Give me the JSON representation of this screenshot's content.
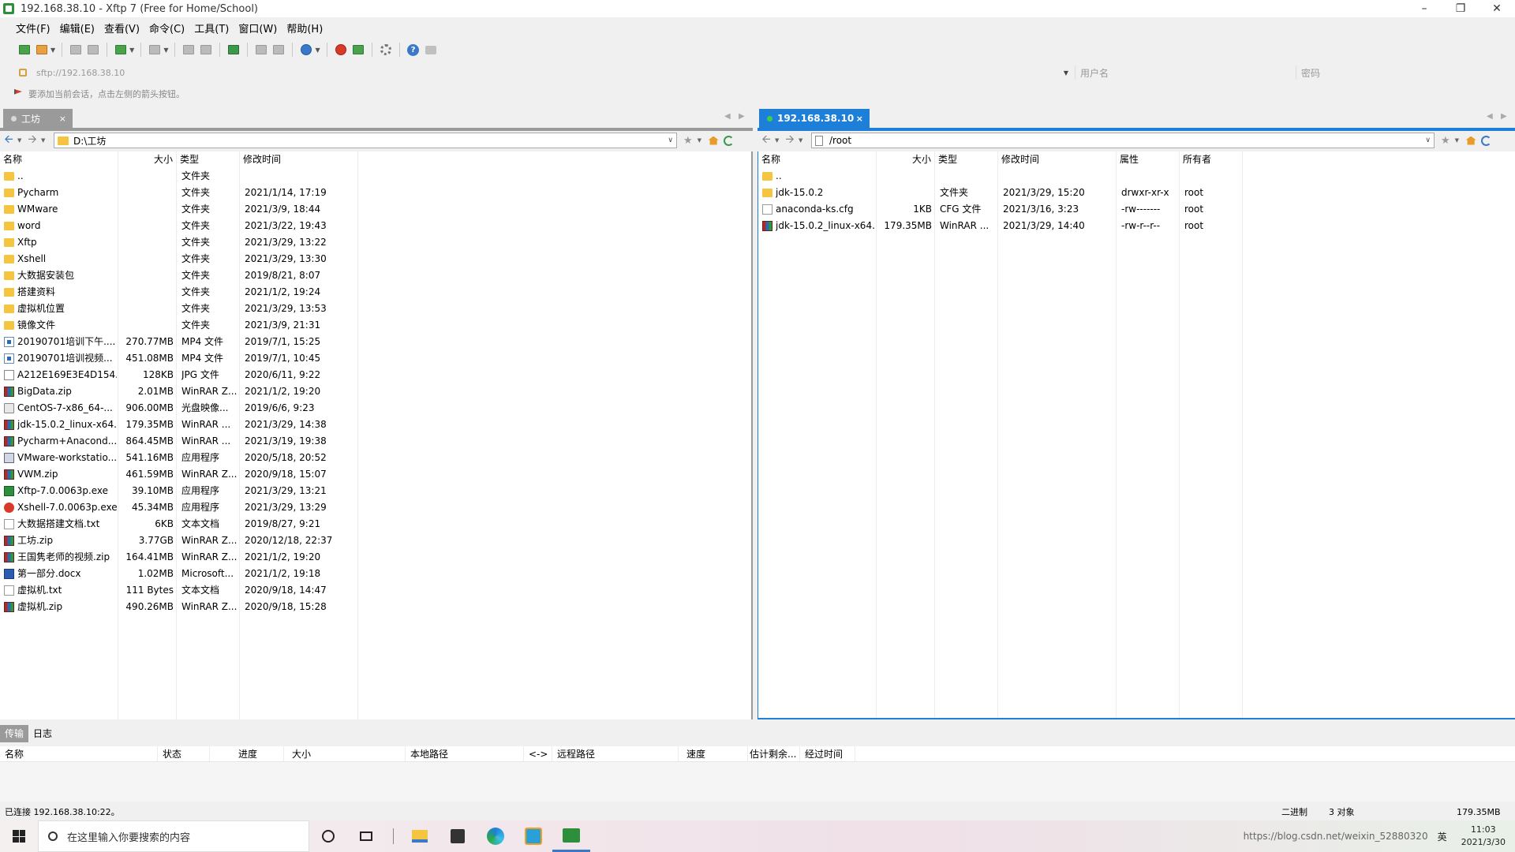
{
  "window": {
    "title": "192.168.38.10 - Xftp 7 (Free for Home/School)"
  },
  "menu": [
    "文件(F)",
    "编辑(E)",
    "查看(V)",
    "命令(C)",
    "工具(T)",
    "窗口(W)",
    "帮助(H)"
  ],
  "address": {
    "value": "sftp://192.168.38.10",
    "username_placeholder": "用户名",
    "password_placeholder": "密码"
  },
  "hint": "要添加当前会话，点击左侧的箭头按钮。",
  "local": {
    "tab_label": "工坊",
    "path": "D:\\工坊",
    "columns": [
      "名称",
      "大小",
      "类型",
      "修改时间"
    ],
    "rows": [
      {
        "icon": "folder",
        "name": "..",
        "size": "",
        "type": "文件夹",
        "mtime": ""
      },
      {
        "icon": "folder",
        "name": "Pycharm",
        "size": "",
        "type": "文件夹",
        "mtime": "2021/1/14, 17:19"
      },
      {
        "icon": "folder",
        "name": "WMware",
        "size": "",
        "type": "文件夹",
        "mtime": "2021/3/9, 18:44"
      },
      {
        "icon": "folder",
        "name": "word",
        "size": "",
        "type": "文件夹",
        "mtime": "2021/3/22, 19:43"
      },
      {
        "icon": "folder",
        "name": "Xftp",
        "size": "",
        "type": "文件夹",
        "mtime": "2021/3/29, 13:22"
      },
      {
        "icon": "folder",
        "name": "Xshell",
        "size": "",
        "type": "文件夹",
        "mtime": "2021/3/29, 13:30"
      },
      {
        "icon": "folder",
        "name": "大数据安装包",
        "size": "",
        "type": "文件夹",
        "mtime": "2019/8/21, 8:07"
      },
      {
        "icon": "folder",
        "name": "搭建资料",
        "size": "",
        "type": "文件夹",
        "mtime": "2021/1/2, 19:24"
      },
      {
        "icon": "folder",
        "name": "虚拟机位置",
        "size": "",
        "type": "文件夹",
        "mtime": "2021/3/29, 13:53"
      },
      {
        "icon": "folder",
        "name": "镜像文件",
        "size": "",
        "type": "文件夹",
        "mtime": "2021/3/9, 21:31"
      },
      {
        "icon": "video",
        "name": "20190701培训下午....",
        "size": "270.77MB",
        "type": "MP4 文件",
        "mtime": "2019/7/1, 15:25"
      },
      {
        "icon": "video",
        "name": "20190701培训视频...",
        "size": "451.08MB",
        "type": "MP4 文件",
        "mtime": "2019/7/1, 10:45"
      },
      {
        "icon": "img",
        "name": "A212E169E3E4D154...",
        "size": "128KB",
        "type": "JPG 文件",
        "mtime": "2020/6/11, 9:22"
      },
      {
        "icon": "zip",
        "name": "BigData.zip",
        "size": "2.01MB",
        "type": "WinRAR Z...",
        "mtime": "2021/1/2, 19:20"
      },
      {
        "icon": "iso",
        "name": "CentOS-7-x86_64-...",
        "size": "906.00MB",
        "type": "光盘映像...",
        "mtime": "2019/6/6, 9:23"
      },
      {
        "icon": "zip",
        "name": "jdk-15.0.2_linux-x64...",
        "size": "179.35MB",
        "type": "WinRAR ...",
        "mtime": "2021/3/29, 14:38"
      },
      {
        "icon": "zip",
        "name": "Pycharm+Anacond...",
        "size": "864.45MB",
        "type": "WinRAR ...",
        "mtime": "2021/3/19, 19:38"
      },
      {
        "icon": "exe",
        "name": "VMware-workstatio...",
        "size": "541.16MB",
        "type": "应用程序",
        "mtime": "2020/5/18, 20:52"
      },
      {
        "icon": "zip",
        "name": "VWM.zip",
        "size": "461.59MB",
        "type": "WinRAR Z...",
        "mtime": "2020/9/18, 15:07"
      },
      {
        "icon": "xftp",
        "name": "Xftp-7.0.0063p.exe",
        "size": "39.10MB",
        "type": "应用程序",
        "mtime": "2021/3/29, 13:21"
      },
      {
        "icon": "xshell",
        "name": "Xshell-7.0.0063p.exe",
        "size": "45.34MB",
        "type": "应用程序",
        "mtime": "2021/3/29, 13:29"
      },
      {
        "icon": "txt",
        "name": "大数据搭建文档.txt",
        "size": "6KB",
        "type": "文本文档",
        "mtime": "2019/8/27, 9:21"
      },
      {
        "icon": "zip",
        "name": "工坊.zip",
        "size": "3.77GB",
        "type": "WinRAR Z...",
        "mtime": "2020/12/18, 22:37"
      },
      {
        "icon": "zip",
        "name": "王国隽老师的视频.zip",
        "size": "164.41MB",
        "type": "WinRAR Z...",
        "mtime": "2021/1/2, 19:20"
      },
      {
        "icon": "doc",
        "name": "第一部分.docx",
        "size": "1.02MB",
        "type": "Microsoft...",
        "mtime": "2021/1/2, 19:18"
      },
      {
        "icon": "txt",
        "name": "虚拟机.txt",
        "size": "111 Bytes",
        "type": "文本文档",
        "mtime": "2020/9/18, 14:47"
      },
      {
        "icon": "zip",
        "name": "虚拟机.zip",
        "size": "490.26MB",
        "type": "WinRAR Z...",
        "mtime": "2020/9/18, 15:28"
      }
    ]
  },
  "remote": {
    "tab_label": "192.168.38.10",
    "path": "/root",
    "columns": [
      "名称",
      "大小",
      "类型",
      "修改时间",
      "属性",
      "所有者"
    ],
    "rows": [
      {
        "icon": "folder",
        "name": "..",
        "size": "",
        "type": "",
        "mtime": "",
        "attr": "",
        "owner": ""
      },
      {
        "icon": "folder",
        "name": "jdk-15.0.2",
        "size": "",
        "type": "文件夹",
        "mtime": "2021/3/29, 15:20",
        "attr": "drwxr-xr-x",
        "owner": "root"
      },
      {
        "icon": "cfg",
        "name": "anaconda-ks.cfg",
        "size": "1KB",
        "type": "CFG 文件",
        "mtime": "2021/3/16, 3:23",
        "attr": "-rw-------",
        "owner": "root"
      },
      {
        "icon": "zip",
        "name": "jdk-15.0.2_linux-x64...",
        "size": "179.35MB",
        "type": "WinRAR ...",
        "mtime": "2021/3/29, 14:40",
        "attr": "-rw-r--r--",
        "owner": "root"
      }
    ]
  },
  "transfer": {
    "tabs": [
      "传输",
      "日志"
    ],
    "columns": [
      "名称",
      "状态",
      "进度",
      "大小",
      "本地路径",
      "<->",
      "远程路径",
      "速度",
      "估计剩余...",
      "经过时间"
    ]
  },
  "status": {
    "left": "已连接 192.168.38.10:22。",
    "mode": "二进制",
    "count": "3 对象",
    "size": "179.35MB"
  },
  "taskbar": {
    "search_placeholder": "在这里输入你要搜索的内容",
    "tray_text": "https://blog.csdn.net/weixin_52880320",
    "ime": "英",
    "time": "11:03",
    "date": "2021/3/30"
  },
  "colors": {
    "accent": "#1e7fd8",
    "inactive_tab": "#9a9a9a",
    "folder": "#f5c542"
  }
}
